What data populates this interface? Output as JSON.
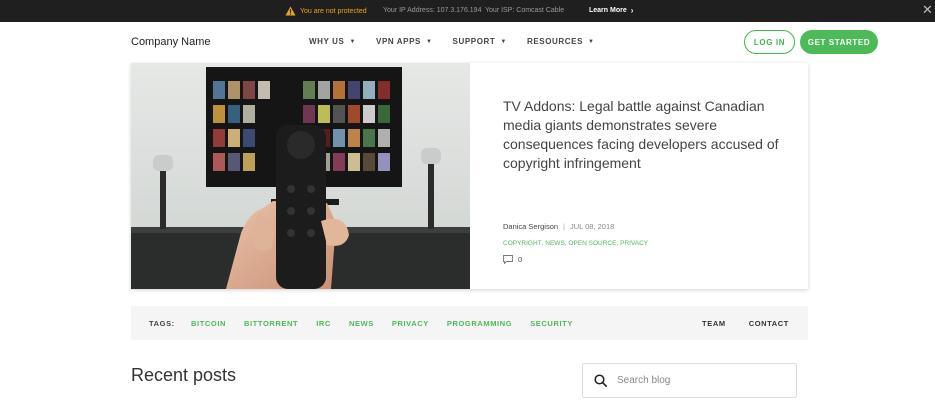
{
  "topbar": {
    "warning": "You are not protected",
    "ip": "Your IP Address: 107.3.176.194",
    "isp": "Your ISP: Comcast Cable",
    "learn_more": "Learn More"
  },
  "header": {
    "brand": "Company Name",
    "nav": [
      {
        "label": "WHY US"
      },
      {
        "label": "VPN APPS"
      },
      {
        "label": "SUPPORT"
      },
      {
        "label": "RESOURCES"
      }
    ],
    "login": "LOG IN",
    "get_started": "GET STARTED"
  },
  "hero": {
    "title": "TV Addons: Legal battle against Canadian media giants demonstrates severe consequences facing developers accused of copyright infringement",
    "author": "Danica Sergison",
    "date": "JUL 08, 2018",
    "categories": [
      "COPYRIGHT",
      "NEWS",
      "OPEN SOURCE",
      "PRIVACY"
    ],
    "comments": "0"
  },
  "tags": {
    "label": "TAGS:",
    "items": [
      "BITCOIN",
      "BITTORRENT",
      "IRC",
      "NEWS",
      "PRIVACY",
      "PROGRAMMING",
      "SECURITY"
    ],
    "team": "TEAM",
    "contact": "CONTACT"
  },
  "recent": {
    "title": "Recent posts"
  },
  "search": {
    "placeholder": "Search blog"
  },
  "colors": {
    "accent": "#4cbb57",
    "warning": "#f0a020",
    "topbar": "#1f1f1f"
  }
}
